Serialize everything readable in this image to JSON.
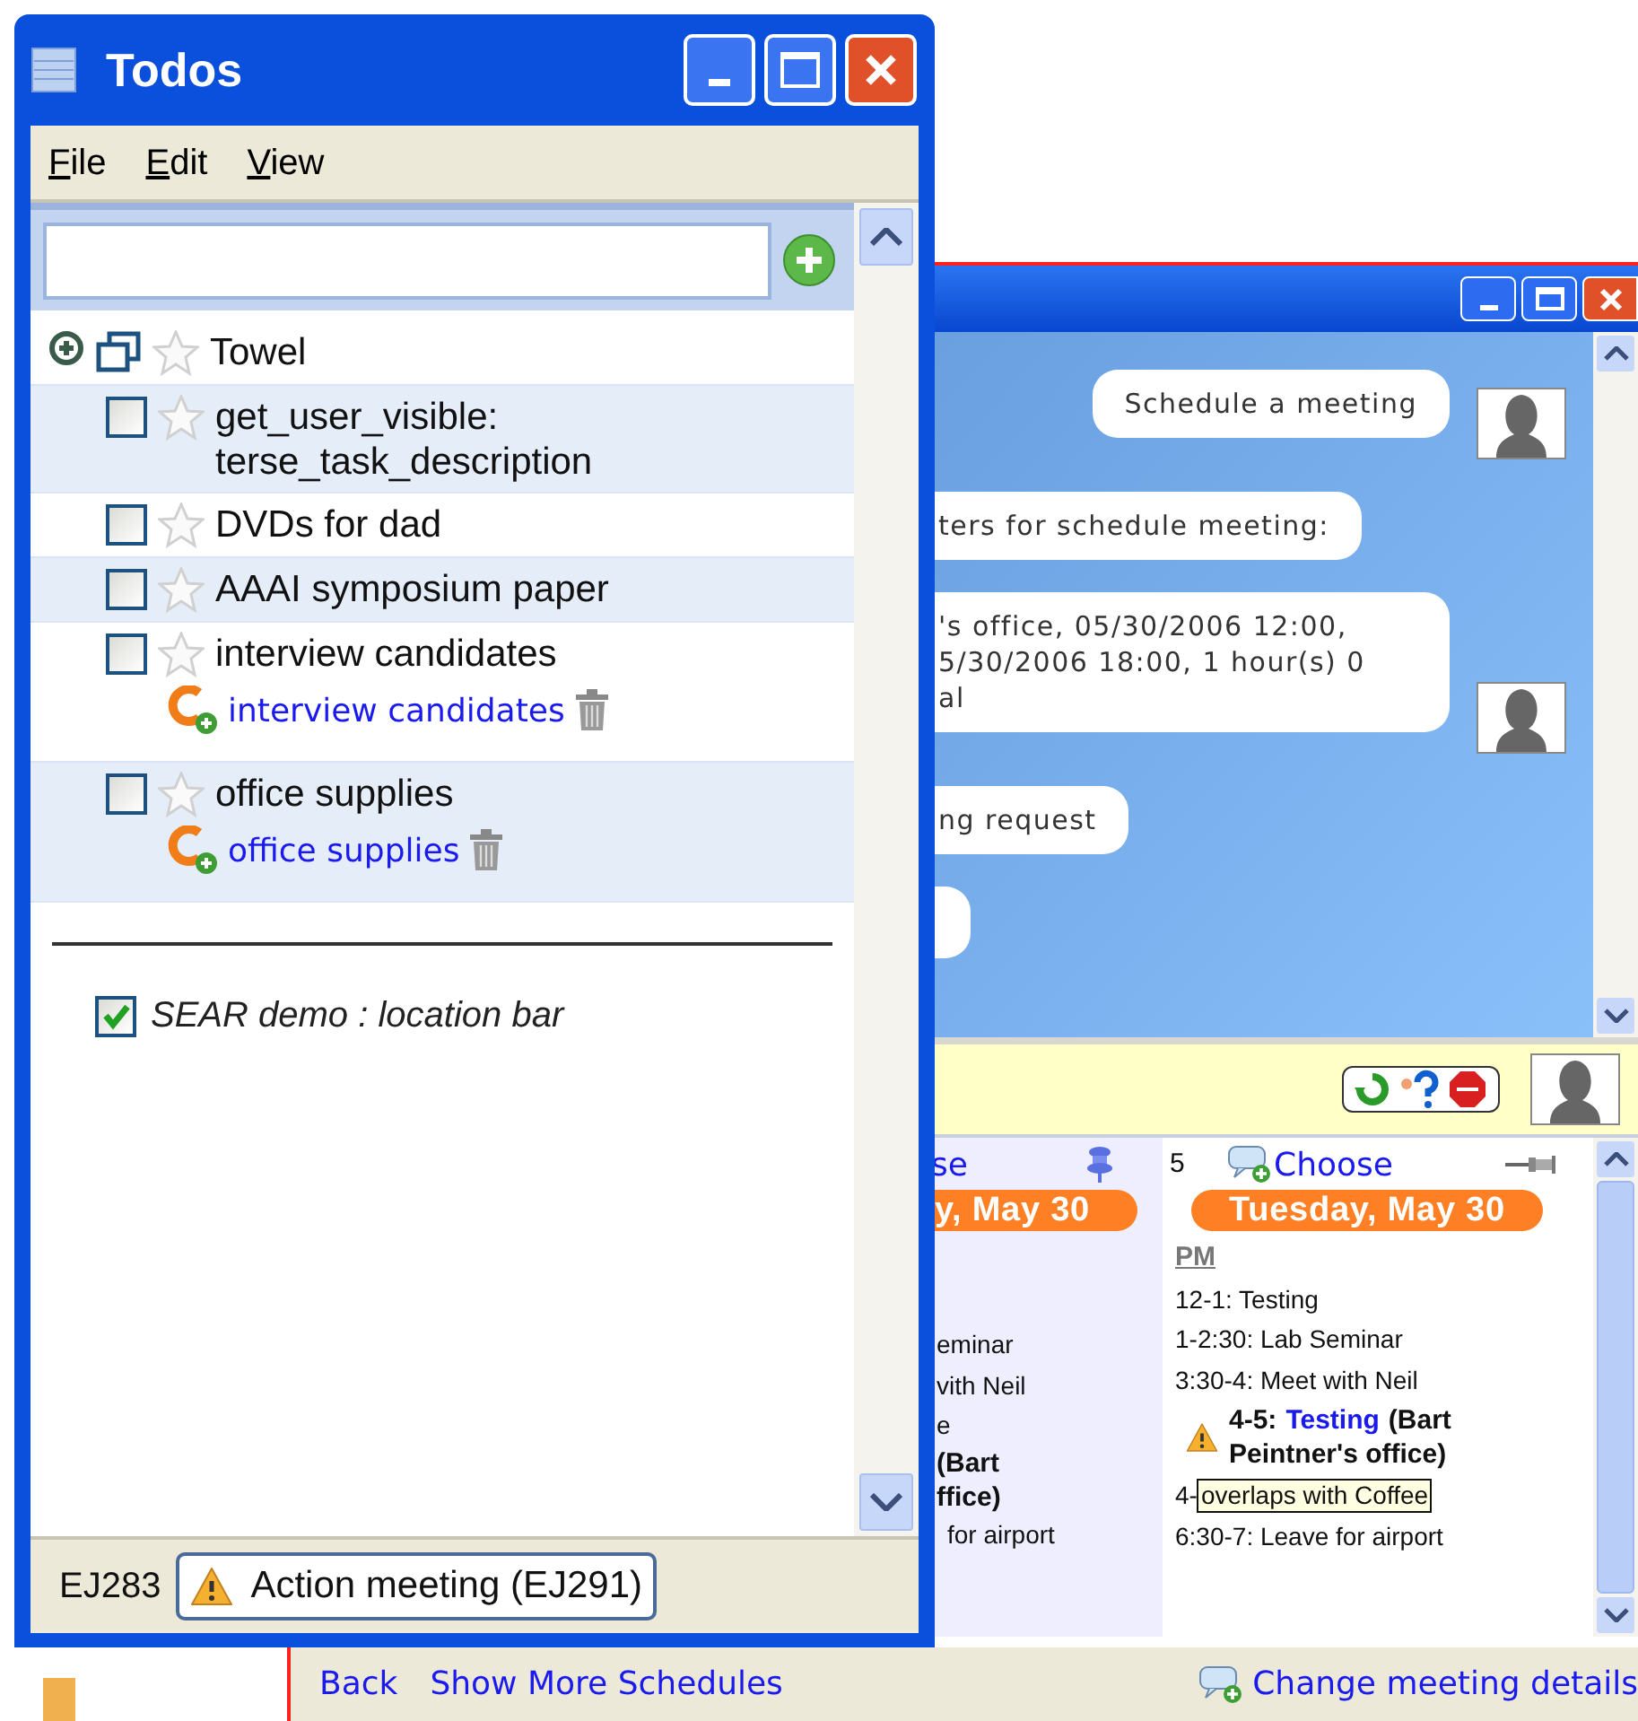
{
  "todos_window": {
    "title": "Todos",
    "menu": [
      "File",
      "Edit",
      "View"
    ],
    "items": [
      {
        "kind": "group",
        "label": "Towel",
        "starred": false,
        "expanded": false
      },
      {
        "kind": "task",
        "label": "get_user_visible:\nterse_task_description",
        "checked": false,
        "starred": false
      },
      {
        "kind": "task",
        "label": "DVDs for dad",
        "checked": false,
        "starred": false
      },
      {
        "kind": "task",
        "label": "AAAI symposium paper",
        "checked": false,
        "starred": false
      },
      {
        "kind": "task",
        "label": "interview candidates",
        "checked": false,
        "starred": false,
        "links": [
          "interview candidates"
        ]
      },
      {
        "kind": "task",
        "label": "office supplies",
        "checked": false,
        "starred": false,
        "links": [
          "office supplies"
        ]
      }
    ],
    "completed": [
      {
        "label": "SEAR demo : location bar",
        "checked": true
      }
    ],
    "status_bar": {
      "id": "EJ283",
      "action": "Action meeting (EJ291)"
    }
  },
  "assistant_window": {
    "messages": [
      {
        "kind": "user",
        "clipped": false,
        "lines": [
          "Schedule a meeting"
        ]
      },
      {
        "kind": "agent",
        "clipped": true,
        "lines": [
          "ters for schedule meeting:"
        ]
      },
      {
        "kind": "user",
        "clipped": true,
        "lines": [
          "'s office, 05/30/2006 12:00,",
          "5/30/2006 18:00, 1 hour(s) 0",
          "al"
        ]
      },
      {
        "kind": "agent",
        "clipped": true,
        "lines": [
          "ng request"
        ]
      },
      {
        "kind": "agent",
        "clipped": true
      }
    ],
    "days": [
      {
        "choose": "se",
        "date": "y, May 30",
        "events": [
          {
            "kind": "plain",
            "text": "eminar"
          },
          {
            "kind": "plain",
            "text": "vith Neil"
          },
          {
            "kind": "plain",
            "text": "e"
          },
          {
            "kind": "bold",
            "lines": [
              "(Bart",
              "ffice)"
            ]
          },
          {
            "kind": "plain",
            "text": "for airport"
          }
        ]
      },
      {
        "number": "5",
        "choose": "Choose",
        "date": "Tuesday, May 30",
        "period": "PM",
        "events": [
          {
            "kind": "plain",
            "text": "12-1: Testing"
          },
          {
            "kind": "plain",
            "text": "1-2:30: Lab Seminar"
          },
          {
            "kind": "plain",
            "text": "3:30-4: Meet with Neil"
          },
          {
            "kind": "conflict",
            "time": "4-5:",
            "title": "Testing",
            "location": "(Bart",
            "location_2": "Peintner's office)"
          },
          {
            "kind": "tooltip",
            "text": "4-",
            "tooltip": "overlaps with Coffee"
          },
          {
            "kind": "plain",
            "text": "6:30-7: Leave for airport"
          }
        ]
      }
    ],
    "footer": {
      "links": [
        "Back",
        "Show More Schedules"
      ],
      "action": "Change meeting details"
    }
  }
}
